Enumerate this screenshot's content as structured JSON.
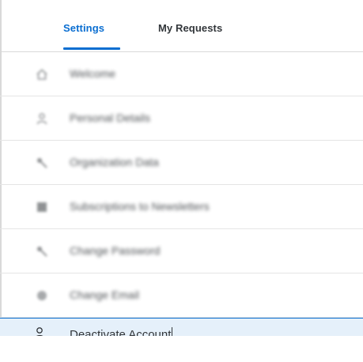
{
  "tabs": [
    {
      "label": "Settings",
      "active": true
    },
    {
      "label": "My Requests",
      "active": false
    }
  ],
  "menu": [
    {
      "label": "Welcome",
      "icon": "home-icon"
    },
    {
      "label": "Personal Details",
      "icon": "person-icon"
    },
    {
      "label": "Organization Data",
      "icon": "key-icon"
    },
    {
      "label": "Subscriptions to Newsletters",
      "icon": "newsletter-icon"
    },
    {
      "label": "Change Password",
      "icon": "key-icon"
    },
    {
      "label": "Change Email",
      "icon": "globe-icon"
    },
    {
      "label": "Deactivate Account",
      "icon": "deactivate-user-icon",
      "active": true
    }
  ],
  "colors": {
    "accent": "#0a6ed1",
    "active_background": "#e5f0fa",
    "text": "#32363a",
    "divider": "#e5e5e5"
  }
}
